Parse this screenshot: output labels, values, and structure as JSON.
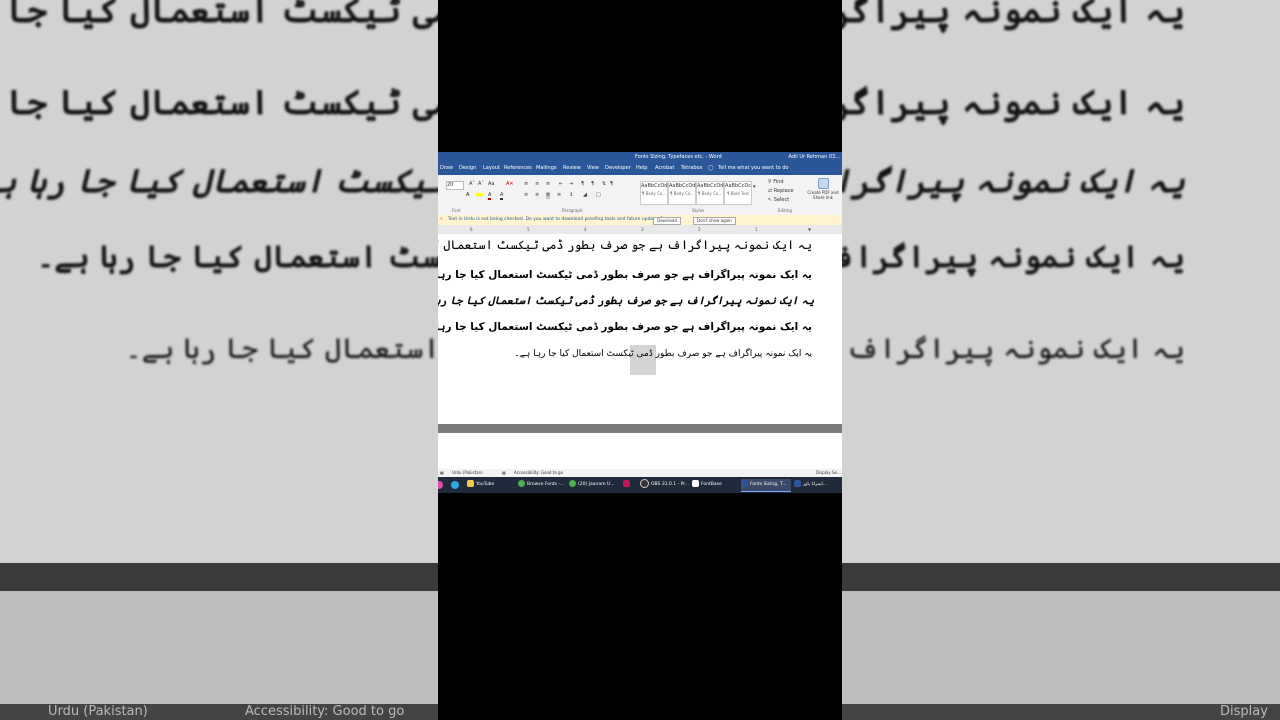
{
  "app": {
    "title": "Fonts Sizing, Typefaces etc.  -  Word",
    "user": "Adil Ur Rehman 03..."
  },
  "ribbon": {
    "tabs": [
      "Draw",
      "Design",
      "Layout",
      "References",
      "Mailings",
      "Review",
      "View",
      "Developer",
      "Help",
      "Acrobat",
      "Tetrabox"
    ],
    "tell_me": "Tell me what you want to do",
    "font_size": "20",
    "styles": [
      {
        "preview": "AaBbCcDdI",
        "name": "¶ Body Co..."
      },
      {
        "preview": "AaBbCcDdI",
        "name": "¶ Body Co..."
      },
      {
        "preview": "AaBbCcDdI",
        "name": "¶ Body Co..."
      },
      {
        "preview": "AaBbCcDc",
        "name": "¶ Bold Text"
      }
    ],
    "editing": {
      "find": "Find",
      "replace": "Replace",
      "select": "Select"
    },
    "acrobat": "Create PDF and Share link",
    "groups": {
      "font": "Font",
      "paragraph": "Paragraph",
      "styles": "Styles",
      "editing": "Editing"
    }
  },
  "message_bar": {
    "text": "Text in Urdu is not being checked. Do you want to download proofing tools and future updates?",
    "download_label": "Download",
    "dont_show_label": "Don't show again"
  },
  "ruler": {
    "ticks": [
      "6",
      "5",
      "4",
      "3",
      "2",
      "1"
    ]
  },
  "document": {
    "paragraphs": [
      "یہ ایک نمونہ پیراگراف ہے جو صرف بطور ڈمی ٹیکسٹ استعمال کیا جا رہا ہے۔",
      "یہ ایک نمونہ پیراگراف ہے جو صرف بطور ڈمی ٹیکسٹ استعمال کیا جا رہا ہے۔",
      "یہ ایک نمونہ پیراگراف ہے جو صرف بطور ڈمی ٹیکسٹ استعمال کیا جا رہا ہے۔",
      "یہ ایک نمونہ پیراگراف ہے جو صرف بطور ڈمی ٹیکسٹ استعمال کیا جا رہا ہے۔",
      "یہ ایک نمونہ پیراگراف ہے جو صرف بطور ڈمی ٹیکسٹ استعمال کیا جا رہا ہے۔"
    ]
  },
  "status_bar": {
    "language": "Urdu (Pakistan)",
    "accessibility": "Accessibility: Good to go",
    "display": "Display Se..."
  },
  "taskbar": {
    "items": [
      "YouTube",
      "Browse Fonts -...",
      "(20) Jaanam U...",
      "OBS 31.0.1 - Pr...",
      "FontBase",
      "Fonts Sizing, T...",
      "ایمرلڈ پاور..."
    ]
  },
  "background": {
    "lines": [
      "یہ ایک نمونہ پیراگراف ہے جو صرف بطور ڈمی ٹیکسٹ استعمال کیا جا رہا ہے۔",
      "یہ ایک نمونہ پیراگراف ہے جو صرف بطور ڈمی ٹیکسٹ استعمال کیا جا رہا ہے۔",
      "یہ ایک نمونہ پیراگراف ہے جو صرف بطور ڈمی ٹیکسٹ استعمال کیا جا رہا ہے۔",
      "یہ ایک نمونہ پیراگراف ہے جو صرف بطور ڈمی ٹیکسٹ استعمال کیا جا رہا ہے۔",
      "یہ ایک نمونہ پیراگراف ہے جو صرف بطور ڈمی ٹیکسٹ استعمال کیا جا رہا ہے۔"
    ],
    "status_language": "Urdu (Pakistan)",
    "status_accessibility": "Accessibility: Good to go",
    "status_display": "Display Se"
  },
  "colors": {
    "word_blue": "#2b579a",
    "message_bar": "#fff4ce",
    "taskbar": "#202a3a"
  }
}
